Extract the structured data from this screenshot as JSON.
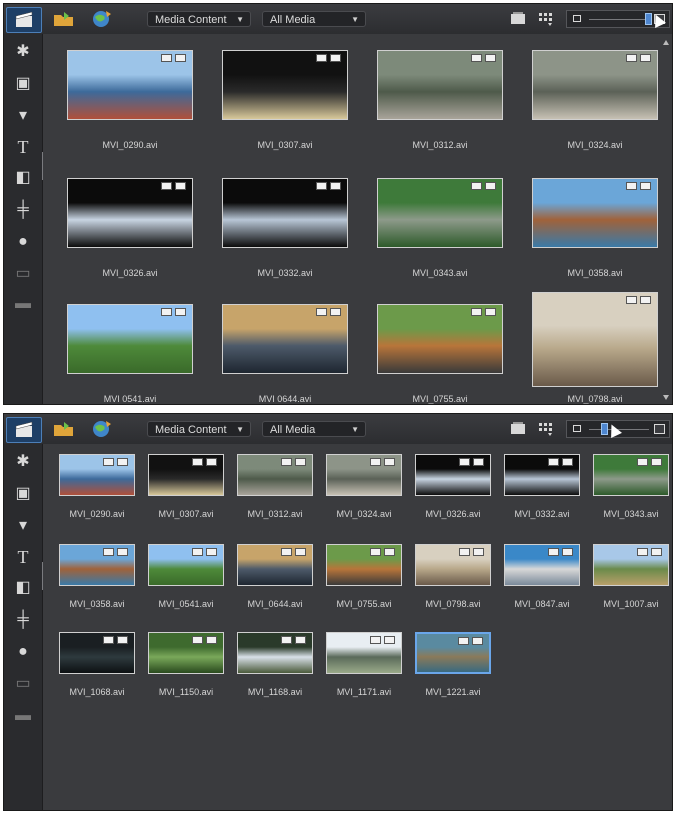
{
  "app": {
    "accent": "#4c7fb8"
  },
  "toolbar": {
    "import_icon": "folder-import-icon",
    "capture_icon": "globe-capture-icon",
    "filter_content": "Media Content",
    "filter_type": "All Media"
  },
  "sidebar": {
    "items": [
      "media-room",
      "fx-room",
      "transition-room",
      "particle-room",
      "title-room",
      "voiceover-room",
      "audio-mixing-room",
      "record-room",
      "chapter-room",
      "subtitle-room"
    ]
  },
  "top_panel": {
    "thumb_size_level": 0.95,
    "files": [
      "MVI_0290.avi",
      "MVI_0307.avi",
      "MVI_0312.avi",
      "MVI_0324.avi",
      "MVI_0326.avi",
      "MVI_0332.avi",
      "MVI_0343.avi",
      "MVI_0358.avi",
      "MVI 0541.avi",
      "MVI 0644.avi",
      "MVI_0755.avi",
      "MVI_0798.avi"
    ]
  },
  "bottom_panel": {
    "thumb_size_level": 0.2,
    "files": [
      "MVI_0290.avi",
      "MVI_0307.avi",
      "MVI_0312.avi",
      "MVI_0324.avi",
      "MVI_0326.avi",
      "MVI_0332.avi",
      "MVI_0343.avi",
      "MVI_0358.avi",
      "MVI_0541.avi",
      "MVI_0644.avi",
      "MVI_0755.avi",
      "MVI_0798.avi",
      "MVI_0847.avi",
      "MVI_1007.avi",
      "MVI_1068.avi",
      "MVI_1150.avi",
      "MVI_1168.avi",
      "MVI_1171.avi",
      "MVI_1221.avi"
    ],
    "selected": "MVI_1221.avi"
  }
}
